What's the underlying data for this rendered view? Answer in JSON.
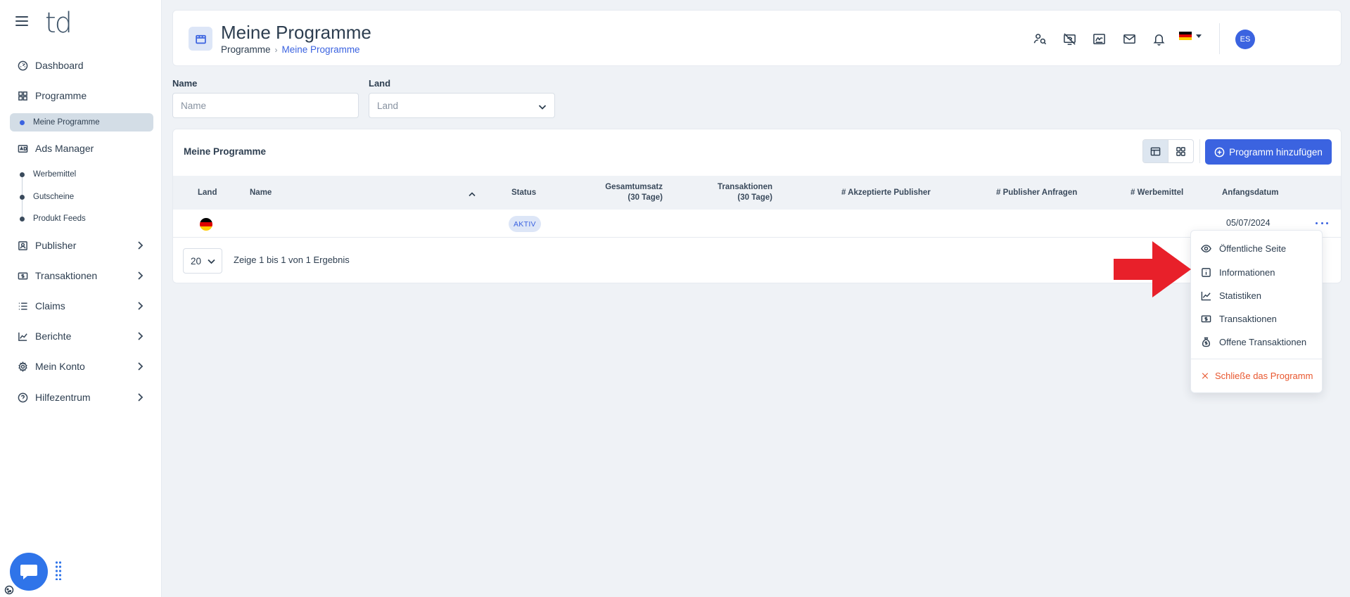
{
  "app": {
    "logo_text": "td"
  },
  "sidebar": {
    "items": [
      {
        "label": "Dashboard",
        "icon": "dashboard-icon"
      },
      {
        "label": "Programme",
        "icon": "grid-icon"
      },
      {
        "label": "Ads Manager",
        "icon": "ads-icon"
      },
      {
        "label": "Publisher",
        "icon": "publisher-icon"
      },
      {
        "label": "Transaktionen",
        "icon": "money-icon"
      },
      {
        "label": "Claims",
        "icon": "list-icon"
      },
      {
        "label": "Berichte",
        "icon": "chart-icon"
      },
      {
        "label": "Mein Konto",
        "icon": "gear-icon"
      },
      {
        "label": "Hilfezentrum",
        "icon": "help-icon"
      }
    ],
    "programme_sub": [
      {
        "label": "Meine Programme",
        "active": true
      }
    ],
    "ads_sub": [
      {
        "label": "Werbemittel"
      },
      {
        "label": "Gutscheine"
      },
      {
        "label": "Produkt Feeds"
      }
    ]
  },
  "header": {
    "title": "Meine Programme",
    "breadcrumb": {
      "home": "Programme",
      "separator": "›",
      "current": "Meine Programme"
    },
    "avatar_initials": "ES",
    "language_flag": "de-flag-icon"
  },
  "filters": {
    "name_label": "Name",
    "name_placeholder": "Name",
    "country_label": "Land",
    "country_placeholder": "Land"
  },
  "table_card": {
    "title": "Meine Programme",
    "add_button_label": "Programm hinzufügen",
    "columns": {
      "land": "Land",
      "name": "Name",
      "status": "Status",
      "gesamtumsatz": "Gesamtumsatz",
      "gesamtumsatz_sub": "(30 Tage)",
      "transaktionen": "Transaktionen",
      "transaktionen_sub": "(30 Tage)",
      "akzeptierte": "# Akzeptierte Publisher",
      "anfragen": "# Publisher Anfragen",
      "werbemittel": "# Werbemittel",
      "anfangsdatum": "Anfangsdatum"
    },
    "rows": [
      {
        "country": "de-flag-icon",
        "name": "",
        "status": "AKTIV",
        "start_date": "05/07/2024"
      }
    ],
    "page_size": "20",
    "results_text": "Zeige 1 bis 1 von 1 Ergebnis"
  },
  "row_menu": {
    "items": [
      {
        "label": "Öffentliche Seite",
        "icon": "eye-icon"
      },
      {
        "label": "Informationen",
        "icon": "info-icon"
      },
      {
        "label": "Statistiken",
        "icon": "chart-icon"
      },
      {
        "label": "Transaktionen",
        "icon": "money-icon"
      },
      {
        "label": "Offene Transaktionen",
        "icon": "moneybag-icon"
      }
    ],
    "close_label": "Schließe das Programm"
  },
  "colors": {
    "accent": "#3b63e0",
    "danger": "#e8562e",
    "annotation_arrow": "#e8202a",
    "background": "#eff2f6"
  }
}
